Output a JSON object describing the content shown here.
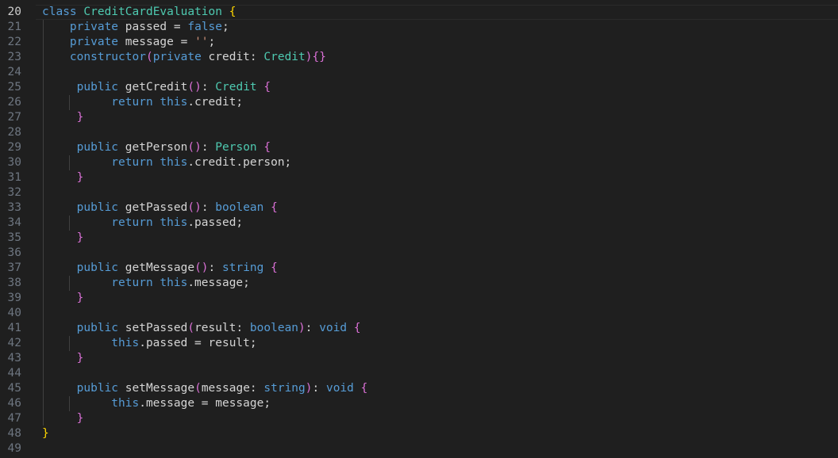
{
  "editor": {
    "active_line": 20,
    "lines": [
      {
        "n": "20",
        "tokens": [
          {
            "t": "class ",
            "c": "kw"
          },
          {
            "t": "CreditCardEvaluation",
            "c": "cls"
          },
          {
            "t": " ",
            "c": "tx"
          },
          {
            "t": "{",
            "c": "b1"
          }
        ]
      },
      {
        "n": "21",
        "tokens": [
          {
            "t": "    private ",
            "c": "kw"
          },
          {
            "t": "passed",
            "c": "tx"
          },
          {
            "t": " = ",
            "c": "tx"
          },
          {
            "t": "false",
            "c": "kw"
          },
          {
            "t": ";",
            "c": "tx"
          }
        ]
      },
      {
        "n": "22",
        "tokens": [
          {
            "t": "    private ",
            "c": "kw"
          },
          {
            "t": "message",
            "c": "tx"
          },
          {
            "t": " = ",
            "c": "tx"
          },
          {
            "t": "''",
            "c": "str"
          },
          {
            "t": ";",
            "c": "tx"
          }
        ]
      },
      {
        "n": "23",
        "tokens": [
          {
            "t": "    constructor",
            "c": "kw"
          },
          {
            "t": "(",
            "c": "b2"
          },
          {
            "t": "private ",
            "c": "kw"
          },
          {
            "t": "credit",
            "c": "tx"
          },
          {
            "t": ": ",
            "c": "tx"
          },
          {
            "t": "Credit",
            "c": "ty"
          },
          {
            "t": ")",
            "c": "b2"
          },
          {
            "t": "{}",
            "c": "b2"
          }
        ]
      },
      {
        "n": "24",
        "tokens": []
      },
      {
        "n": "25",
        "tokens": [
          {
            "t": "     public ",
            "c": "kw"
          },
          {
            "t": "getCredit",
            "c": "tx"
          },
          {
            "t": "()",
            "c": "b2"
          },
          {
            "t": ": ",
            "c": "tx"
          },
          {
            "t": "Credit",
            "c": "ty"
          },
          {
            "t": " ",
            "c": "tx"
          },
          {
            "t": "{",
            "c": "b2"
          }
        ]
      },
      {
        "n": "26",
        "tokens": [
          {
            "t": "          return ",
            "c": "kw"
          },
          {
            "t": "this",
            "c": "kw"
          },
          {
            "t": ".credit;",
            "c": "tx"
          }
        ]
      },
      {
        "n": "27",
        "tokens": [
          {
            "t": "     }",
            "c": "b2"
          }
        ]
      },
      {
        "n": "28",
        "tokens": []
      },
      {
        "n": "29",
        "tokens": [
          {
            "t": "     public ",
            "c": "kw"
          },
          {
            "t": "getPerson",
            "c": "tx"
          },
          {
            "t": "()",
            "c": "b2"
          },
          {
            "t": ": ",
            "c": "tx"
          },
          {
            "t": "Person",
            "c": "ty"
          },
          {
            "t": " ",
            "c": "tx"
          },
          {
            "t": "{",
            "c": "b2"
          }
        ]
      },
      {
        "n": "30",
        "tokens": [
          {
            "t": "          return ",
            "c": "kw"
          },
          {
            "t": "this",
            "c": "kw"
          },
          {
            "t": ".credit.person;",
            "c": "tx"
          }
        ]
      },
      {
        "n": "31",
        "tokens": [
          {
            "t": "     }",
            "c": "b2"
          }
        ]
      },
      {
        "n": "32",
        "tokens": []
      },
      {
        "n": "33",
        "tokens": [
          {
            "t": "     public ",
            "c": "kw"
          },
          {
            "t": "getPassed",
            "c": "tx"
          },
          {
            "t": "()",
            "c": "b2"
          },
          {
            "t": ": ",
            "c": "tx"
          },
          {
            "t": "boolean",
            "c": "kw"
          },
          {
            "t": " ",
            "c": "tx"
          },
          {
            "t": "{",
            "c": "b2"
          }
        ]
      },
      {
        "n": "34",
        "tokens": [
          {
            "t": "          return ",
            "c": "kw"
          },
          {
            "t": "this",
            "c": "kw"
          },
          {
            "t": ".passed;",
            "c": "tx"
          }
        ]
      },
      {
        "n": "35",
        "tokens": [
          {
            "t": "     }",
            "c": "b2"
          }
        ]
      },
      {
        "n": "36",
        "tokens": []
      },
      {
        "n": "37",
        "tokens": [
          {
            "t": "     public ",
            "c": "kw"
          },
          {
            "t": "getMessage",
            "c": "tx"
          },
          {
            "t": "()",
            "c": "b2"
          },
          {
            "t": ": ",
            "c": "tx"
          },
          {
            "t": "string",
            "c": "kw"
          },
          {
            "t": " ",
            "c": "tx"
          },
          {
            "t": "{",
            "c": "b2"
          }
        ]
      },
      {
        "n": "38",
        "tokens": [
          {
            "t": "          return ",
            "c": "kw"
          },
          {
            "t": "this",
            "c": "kw"
          },
          {
            "t": ".message;",
            "c": "tx"
          }
        ]
      },
      {
        "n": "39",
        "tokens": [
          {
            "t": "     }",
            "c": "b2"
          }
        ]
      },
      {
        "n": "40",
        "tokens": []
      },
      {
        "n": "41",
        "tokens": [
          {
            "t": "     public ",
            "c": "kw"
          },
          {
            "t": "setPassed",
            "c": "tx"
          },
          {
            "t": "(",
            "c": "b2"
          },
          {
            "t": "result: ",
            "c": "tx"
          },
          {
            "t": "boolean",
            "c": "kw"
          },
          {
            "t": ")",
            "c": "b2"
          },
          {
            "t": ": ",
            "c": "tx"
          },
          {
            "t": "void",
            "c": "kw"
          },
          {
            "t": " ",
            "c": "tx"
          },
          {
            "t": "{",
            "c": "b2"
          }
        ]
      },
      {
        "n": "42",
        "tokens": [
          {
            "t": "          this",
            "c": "kw"
          },
          {
            "t": ".passed = result;",
            "c": "tx"
          }
        ]
      },
      {
        "n": "43",
        "tokens": [
          {
            "t": "     }",
            "c": "b2"
          }
        ]
      },
      {
        "n": "44",
        "tokens": []
      },
      {
        "n": "45",
        "tokens": [
          {
            "t": "     public ",
            "c": "kw"
          },
          {
            "t": "setMessage",
            "c": "tx"
          },
          {
            "t": "(",
            "c": "b2"
          },
          {
            "t": "message: ",
            "c": "tx"
          },
          {
            "t": "string",
            "c": "kw"
          },
          {
            "t": ")",
            "c": "b2"
          },
          {
            "t": ": ",
            "c": "tx"
          },
          {
            "t": "void",
            "c": "kw"
          },
          {
            "t": " ",
            "c": "tx"
          },
          {
            "t": "{",
            "c": "b2"
          }
        ]
      },
      {
        "n": "46",
        "tokens": [
          {
            "t": "          this",
            "c": "kw"
          },
          {
            "t": ".message = message;",
            "c": "tx"
          }
        ]
      },
      {
        "n": "47",
        "tokens": [
          {
            "t": "     }",
            "c": "b2"
          }
        ]
      },
      {
        "n": "48",
        "tokens": [
          {
            "t": "}",
            "c": "b1"
          }
        ]
      },
      {
        "n": "49",
        "tokens": []
      }
    ]
  },
  "colors": {
    "background": "#1f1f1f",
    "line_number": "#6e7681",
    "line_number_active": "#cccccc",
    "keyword": "#569cd6",
    "type": "#4ec9b0",
    "string": "#ce9178",
    "bracket_level_1": "#ffd700",
    "bracket_level_2": "#da70d6",
    "text": "#d4d4d4"
  }
}
